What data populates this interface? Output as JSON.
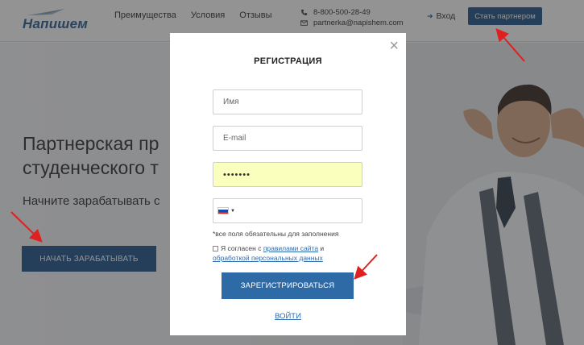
{
  "header": {
    "logo_text": "Напишем",
    "nav": [
      "Преимущества",
      "Условия",
      "Отзывы"
    ],
    "phone": "8-800-500-28-49",
    "email": "partnerka@napishem.com",
    "login": "Вход",
    "partner_button": "Стать партнером"
  },
  "hero": {
    "title_line1": "Партнерская пр",
    "title_line2": "студенческого т",
    "subtitle": "Начните зарабатывать с",
    "cta": "НАЧАТЬ ЗАРАБАТЫВАТЬ"
  },
  "modal": {
    "title": "РЕГИСТРАЦИЯ",
    "close": "×",
    "name_placeholder": "Имя",
    "email_placeholder": "E-mail",
    "password_value": "•••••••",
    "required_note": "*все поля обязательны для заполнения",
    "agree_prefix": "Я согласен с ",
    "agree_link1": "правилами сайта",
    "agree_and": " и",
    "agree_link2": "обработкой персональных данных",
    "register_button": "ЗАРЕГИСТРИРОВАТЬСЯ",
    "signin_link": "ВОЙТИ"
  },
  "colors": {
    "brand_blue": "#22578e",
    "link_blue": "#2d6ab0",
    "autofill_yellow": "#faffbd",
    "annotation_red": "#e02020"
  }
}
